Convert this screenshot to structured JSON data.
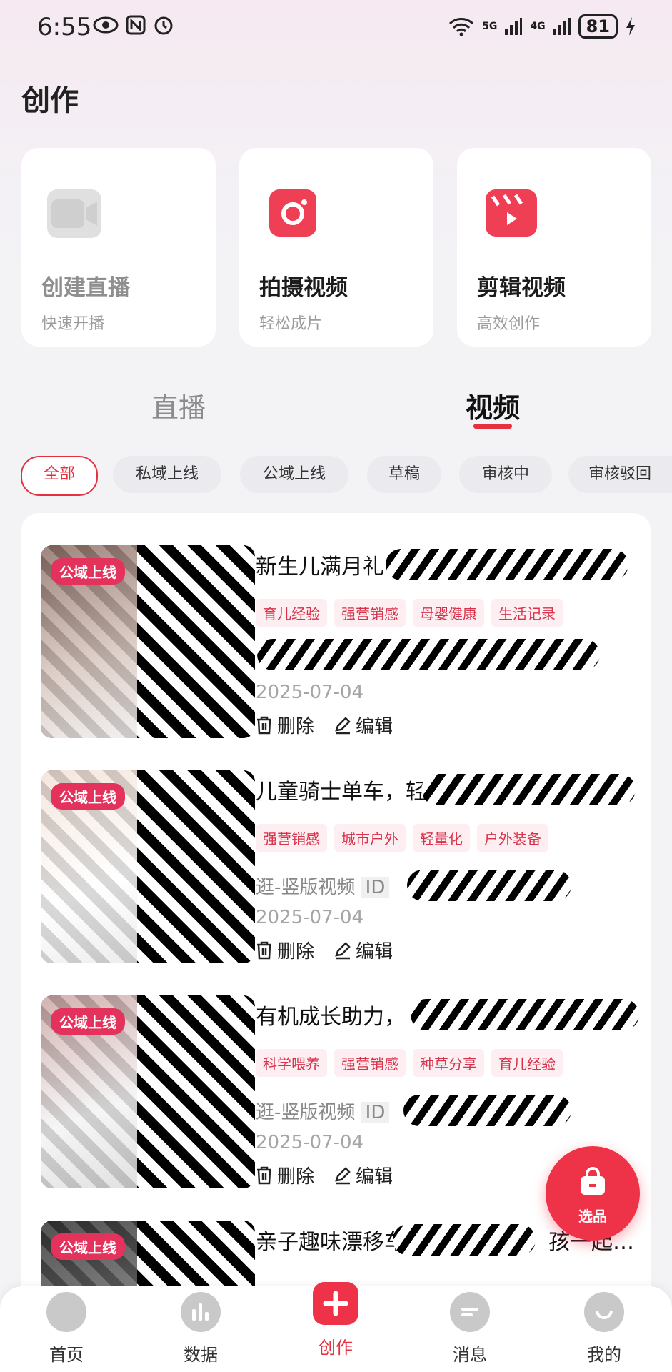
{
  "status": {
    "time": "6:55",
    "network_5g": "5G",
    "network_4g": "4G",
    "battery": "81"
  },
  "page_title": "创作",
  "cards": [
    {
      "title": "创建直播",
      "subtitle": "快速开播",
      "icon": "video-camera-icon"
    },
    {
      "title": "拍摄视频",
      "subtitle": "轻松成片",
      "icon": "camera-icon"
    },
    {
      "title": "剪辑视频",
      "subtitle": "高效创作",
      "icon": "clapperboard-icon"
    }
  ],
  "tabs": [
    {
      "label": "直播"
    },
    {
      "label": "视频",
      "active": true
    }
  ],
  "filters": [
    "全部",
    "私域上线",
    "公域上线",
    "草稿",
    "审核中",
    "审核驳回"
  ],
  "items": [
    {
      "badge": "公域上线",
      "title": "新生儿满月礼",
      "tags": [
        "育儿经验",
        "强营销感",
        "母婴健康",
        "生活记录"
      ],
      "meta": "",
      "date": "2025-07-04",
      "delete": "删除",
      "edit": "编辑"
    },
    {
      "badge": "公域上线",
      "title": "儿童骑士单车，轻骑百搭，一步",
      "tags": [
        "强营销感",
        "城市户外",
        "轻量化",
        "户外装备"
      ],
      "meta": "逛-竖版视频",
      "id_label": "ID",
      "date": "2025-07-04",
      "delete": "删除",
      "edit": "编辑"
    },
    {
      "badge": "公域上线",
      "title": "有机成长助力，",
      "tags": [
        "科学喂养",
        "强营销感",
        "种草分享",
        "育儿经验"
      ],
      "meta": "逛-竖版视频",
      "id_label": "ID",
      "date": "2025-07-04",
      "delete": "删除",
      "edit": "编辑"
    },
    {
      "badge": "公域上线",
      "title": "亲子趣味漂移车",
      "title_tail": "孩一起…",
      "tags": [],
      "meta": "",
      "date": "",
      "delete": "",
      "edit": ""
    }
  ],
  "fab": {
    "label": "选品"
  },
  "nav": [
    {
      "label": "首页",
      "icon": "home-icon"
    },
    {
      "label": "数据",
      "icon": "chart-icon"
    },
    {
      "label": "创作",
      "icon": "plus-icon",
      "active": true
    },
    {
      "label": "消息",
      "icon": "message-icon"
    },
    {
      "label": "我的",
      "icon": "profile-icon"
    }
  ],
  "colors": {
    "accent": "#e4303f",
    "badge": "#e3325c",
    "tag_bg": "#fdeef1"
  }
}
